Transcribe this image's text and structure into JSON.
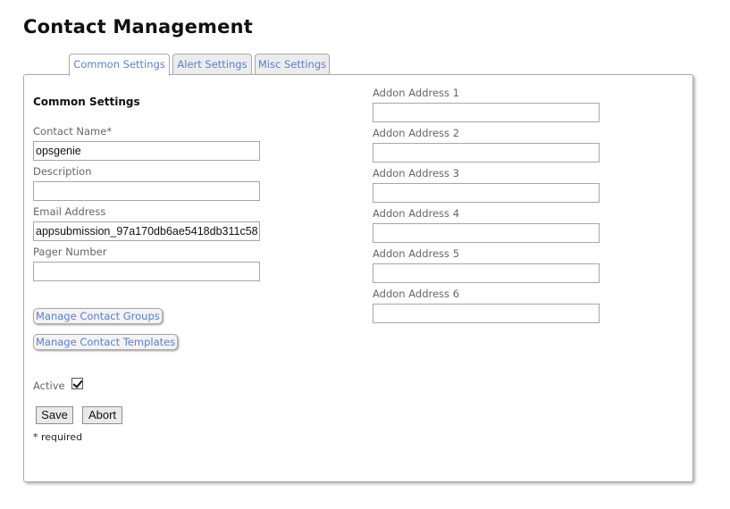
{
  "page": {
    "title": "Contact Management"
  },
  "tabs": [
    {
      "label": "Common Settings",
      "active": true
    },
    {
      "label": "Alert Settings",
      "active": false
    },
    {
      "label": "Misc Settings",
      "active": false
    }
  ],
  "common": {
    "heading": "Common Settings",
    "contact_name_label": "Contact Name*",
    "contact_name_value": "opsgenie",
    "description_label": "Description",
    "description_value": "",
    "email_label": "Email Address",
    "email_value": "appsubmission_97a170db6ae5418db311c58",
    "pager_label": "Pager Number",
    "pager_value": "",
    "manage_groups_label": "Manage Contact Groups",
    "manage_templates_label": "Manage Contact Templates",
    "active_label": "Active",
    "active_checked": true,
    "save_label": "Save",
    "abort_label": "Abort",
    "required_note": "* required"
  },
  "addons": [
    {
      "label": "Addon Address 1",
      "value": ""
    },
    {
      "label": "Addon Address 2",
      "value": ""
    },
    {
      "label": "Addon Address 3",
      "value": ""
    },
    {
      "label": "Addon Address 4",
      "value": ""
    },
    {
      "label": "Addon Address 5",
      "value": ""
    },
    {
      "label": "Addon Address 6",
      "value": ""
    }
  ],
  "colors": {
    "link": "#5b7ed3",
    "label": "#666666",
    "border": "#a9a9a9"
  }
}
